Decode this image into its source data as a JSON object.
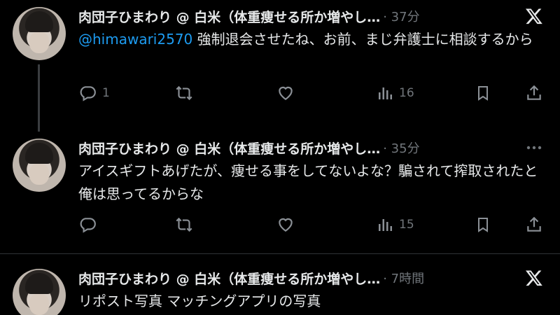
{
  "tweets": [
    {
      "name": "肉団子ひまわり @ 白米（体重痩せる所か増やし…",
      "time": "· 37分",
      "corner_icon": "x-logo",
      "mention": "@himawari2570",
      "text": " 強制退会させたね、お前、まじ弁護士に相談するから",
      "reply_count": "1",
      "views": "16"
    },
    {
      "name": "肉団子ひまわり @ 白米（体重痩せる所か増やし…",
      "time": "· 35分",
      "corner_icon": "more-icon",
      "text": "アイスギフトあげたが、痩せる事をしてないよな？騙されて搾取されたと俺は思ってるからな",
      "reply_count": "",
      "views": "15"
    },
    {
      "name": "肉団子ひまわり @ 白米（体重痩せる所か増やし…",
      "time": "· 7時間",
      "corner_icon": "x-logo",
      "text": "リポスト写真 マッチングアプリの写真"
    }
  ]
}
